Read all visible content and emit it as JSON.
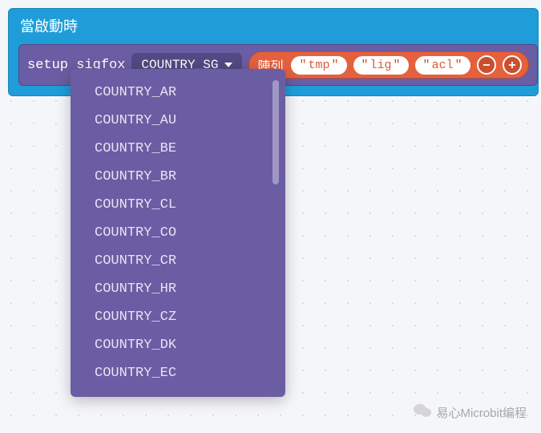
{
  "event_block": {
    "header": "當啟動時"
  },
  "sigfox_block": {
    "label": "setup sigfox",
    "dropdown": {
      "selected": "COUNTRY_SG"
    },
    "array": {
      "label": "陣列",
      "items": [
        "tmp",
        "lig",
        "acl"
      ]
    }
  },
  "dropdown_options": [
    "COUNTRY_AR",
    "COUNTRY_AU",
    "COUNTRY_BE",
    "COUNTRY_BR",
    "COUNTRY_CL",
    "COUNTRY_CO",
    "COUNTRY_CR",
    "COUNTRY_HR",
    "COUNTRY_CZ",
    "COUNTRY_DK",
    "COUNTRY_EC"
  ],
  "watermark": {
    "text": "易心Microbit编程"
  }
}
